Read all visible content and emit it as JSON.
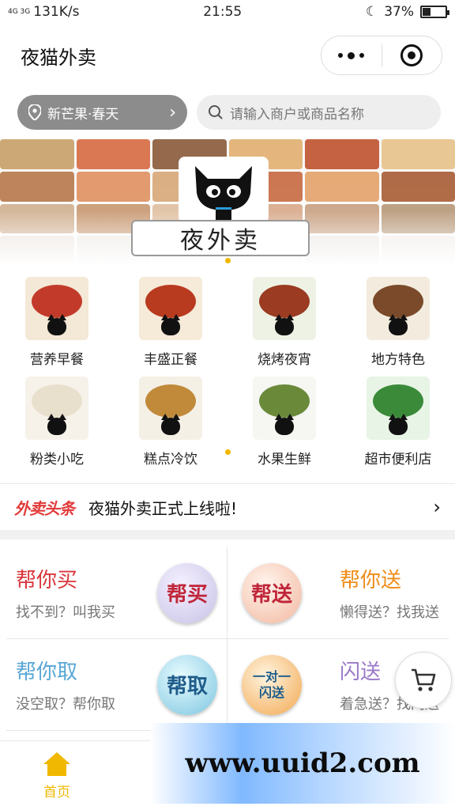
{
  "status": {
    "network": "4G 3G",
    "speed": "131K/s",
    "time": "21:55",
    "battery": "37%",
    "battery_level": 0.37
  },
  "header": {
    "title": "夜猫外卖"
  },
  "search": {
    "location": "新芒果·春天",
    "placeholder": "请输入商户或商品名称"
  },
  "banner": {
    "logo_text": "夜外卖"
  },
  "categories": [
    {
      "label": "营养早餐",
      "icon": "breakfast-icon"
    },
    {
      "label": "丰盛正餐",
      "icon": "meal-icon"
    },
    {
      "label": "烧烤夜宵",
      "icon": "bbq-icon"
    },
    {
      "label": "地方特色",
      "icon": "local-food-icon"
    },
    {
      "label": "粉类小吃",
      "icon": "noodle-icon"
    },
    {
      "label": "糕点冷饮",
      "icon": "drink-icon"
    },
    {
      "label": "水果生鲜",
      "icon": "fruit-icon"
    },
    {
      "label": "超市便利店",
      "icon": "store-icon"
    }
  ],
  "news": {
    "brand": "外卖头条",
    "text": "夜猫外卖正式上线啦!"
  },
  "services": [
    {
      "title": "帮你买",
      "subtitle": "找不到？叫我买",
      "badge": "帮买",
      "color": "#d9353b"
    },
    {
      "title": "帮你送",
      "subtitle": "懒得送？找我送",
      "badge": "帮送",
      "color": "#f08c18"
    },
    {
      "title": "帮你取",
      "subtitle": "没空取？帮你取",
      "badge": "帮取",
      "color": "#59a7d6"
    },
    {
      "title": "闪送",
      "subtitle": "着急送？找闪送",
      "badge": "一对一 闪送",
      "color": "#9a78c8"
    }
  ],
  "tabbar": {
    "home": "首页"
  },
  "watermark": {
    "text": "www.uuid2.com"
  },
  "colors": {
    "accent": "#f0b800",
    "location_bg": "#8c8c8c"
  }
}
